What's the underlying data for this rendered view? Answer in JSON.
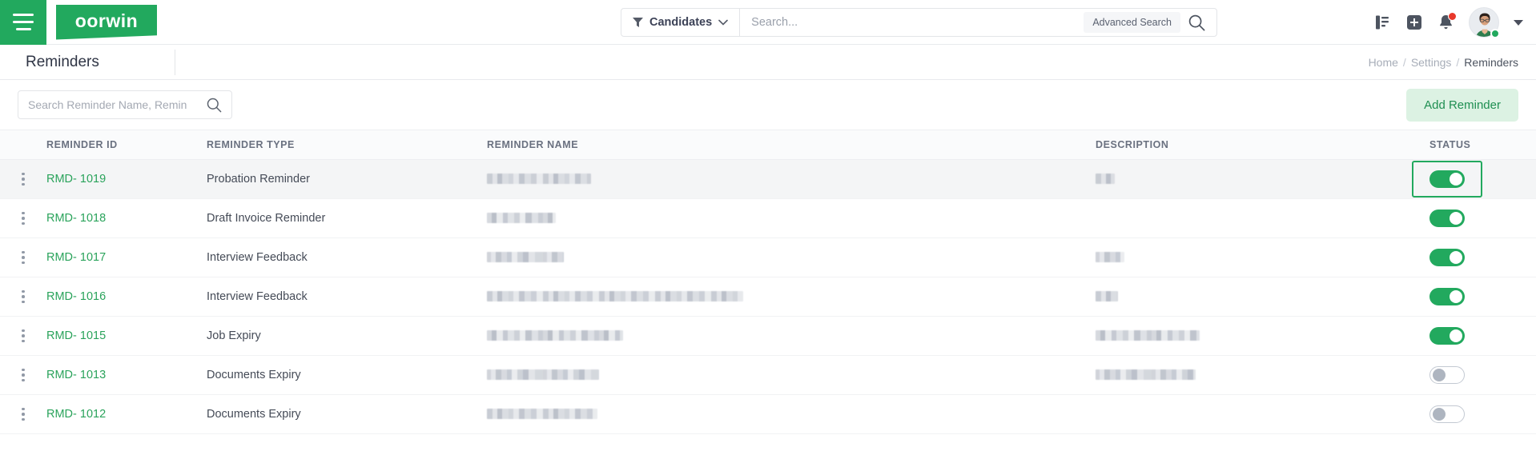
{
  "colors": {
    "brand_green": "#22a95e",
    "link_green": "#2aa35b",
    "accent_soft": "#dcf2e3",
    "danger": "#e8382b"
  },
  "topbar": {
    "menu_icon": "hamburger-icon",
    "brand": "oorwin",
    "module_select": {
      "label": "Candidates",
      "icon": "filter-icon",
      "chevron": "chevron-down-icon"
    },
    "search": {
      "placeholder": "Search...",
      "value": "",
      "advanced_label": "Advanced Search",
      "search_icon": "search-icon"
    },
    "icons": [
      "tasks-icon",
      "add-icon",
      "notifications-icon"
    ],
    "avatar": "user-avatar",
    "profile_caret": "caret-down-icon"
  },
  "titlebar": {
    "title": "Reminders",
    "breadcrumb": {
      "home": "Home",
      "sep1": "/",
      "settings": "Settings",
      "sep2": "/",
      "current": "Reminders"
    }
  },
  "toolbar": {
    "search_placeholder": "Search Reminder Name, Remin",
    "search_value": "",
    "add_label": "Add Reminder"
  },
  "table": {
    "headers": {
      "menu": "",
      "id": "REMINDER ID",
      "type": "REMINDER TYPE",
      "name": "REMINDER NAME",
      "description": "DESCRIPTION",
      "status": "STATUS"
    },
    "rows": [
      {
        "id": "RMD- 1019",
        "type": "Probation Reminder",
        "name_redacted_width": 130,
        "desc_redacted_width": 24,
        "status_on": true,
        "highlighted": true,
        "active": true
      },
      {
        "id": "RMD- 1018",
        "type": "Draft Invoice Reminder",
        "name_redacted_width": 86,
        "desc_redacted_width": 0,
        "status_on": true,
        "highlighted": false,
        "active": false
      },
      {
        "id": "RMD- 1017",
        "type": "Interview Feedback",
        "name_redacted_width": 96,
        "desc_redacted_width": 36,
        "status_on": true,
        "highlighted": false,
        "active": false
      },
      {
        "id": "RMD- 1016",
        "type": "Interview Feedback",
        "name_redacted_width": 320,
        "desc_redacted_width": 28,
        "status_on": true,
        "highlighted": false,
        "active": false
      },
      {
        "id": "RMD- 1015",
        "type": "Job Expiry",
        "name_redacted_width": 170,
        "desc_redacted_width": 130,
        "status_on": true,
        "highlighted": false,
        "active": false
      },
      {
        "id": "RMD- 1013",
        "type": "Documents Expiry",
        "name_redacted_width": 140,
        "desc_redacted_width": 125,
        "status_on": false,
        "highlighted": false,
        "active": false
      },
      {
        "id": "RMD- 1012",
        "type": "Documents Expiry",
        "name_redacted_width": 138,
        "desc_redacted_width": 0,
        "status_on": false,
        "highlighted": false,
        "active": false
      }
    ]
  }
}
